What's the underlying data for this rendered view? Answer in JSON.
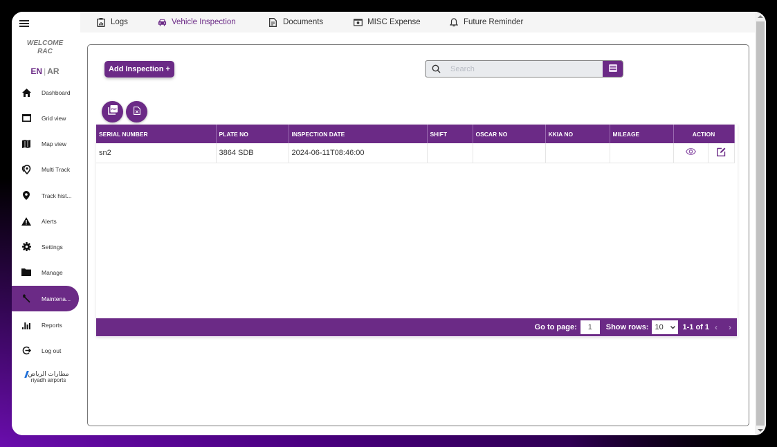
{
  "sidebar": {
    "welcome_line1": "WELCOME",
    "welcome_line2": "RAC",
    "lang_en": "EN",
    "lang_sep": "|",
    "lang_ar": "AR",
    "items": [
      {
        "label": "Dashboard",
        "icon": "home-icon"
      },
      {
        "label": "Grid view",
        "icon": "window-icon"
      },
      {
        "label": "Map view",
        "icon": "map-icon"
      },
      {
        "label": "Multi Track",
        "icon": "multi-location-icon"
      },
      {
        "label": "Track hist...",
        "icon": "location-pin-icon"
      },
      {
        "label": "Alerts",
        "icon": "warning-icon"
      },
      {
        "label": "Settings",
        "icon": "gear-icon"
      },
      {
        "label": "Manage",
        "icon": "folder-icon"
      },
      {
        "label": "Maintena...",
        "icon": "wrench-icon",
        "active": true
      },
      {
        "label": "Reports",
        "icon": "bar-chart-icon"
      },
      {
        "label": "Log out",
        "icon": "logout-icon"
      }
    ],
    "logo_arabic": "مطارات الرياض",
    "logo_english": "riyadh airports"
  },
  "tabs": [
    {
      "label": "Logs",
      "icon": "logs-icon"
    },
    {
      "label": "Vehicle Inspection",
      "icon": "car-icon",
      "active": true
    },
    {
      "label": "Documents",
      "icon": "document-icon"
    },
    {
      "label": "MISC Expense",
      "icon": "money-icon"
    },
    {
      "label": "Future Reminder",
      "icon": "bell-icon"
    }
  ],
  "toolbar": {
    "add_button": "Add Inspection +",
    "search_placeholder": "Search",
    "search_value": ""
  },
  "table": {
    "columns": [
      "SERIAL NUMBER",
      "PLATE NO",
      "INSPECTION DATE",
      "SHIFT",
      "OSCAR NO",
      "KKIA NO",
      "MILEAGE",
      "ACTION"
    ],
    "rows": [
      {
        "serial_number": "sn2",
        "plate_no": "3864 SDB",
        "inspection_date": "2024-06-11T08:46:00",
        "shift": "",
        "oscar_no": "",
        "kkia_no": "",
        "mileage": ""
      }
    ]
  },
  "pagination": {
    "goto_label": "Go to page:",
    "page_value": "1",
    "rows_label": "Show rows:",
    "rows_value": "10",
    "range_text": "1-1 of 1",
    "prev": "‹",
    "next": "›"
  },
  "colors": {
    "accent": "#6b2a86",
    "header_bg": "#6b2a86"
  }
}
